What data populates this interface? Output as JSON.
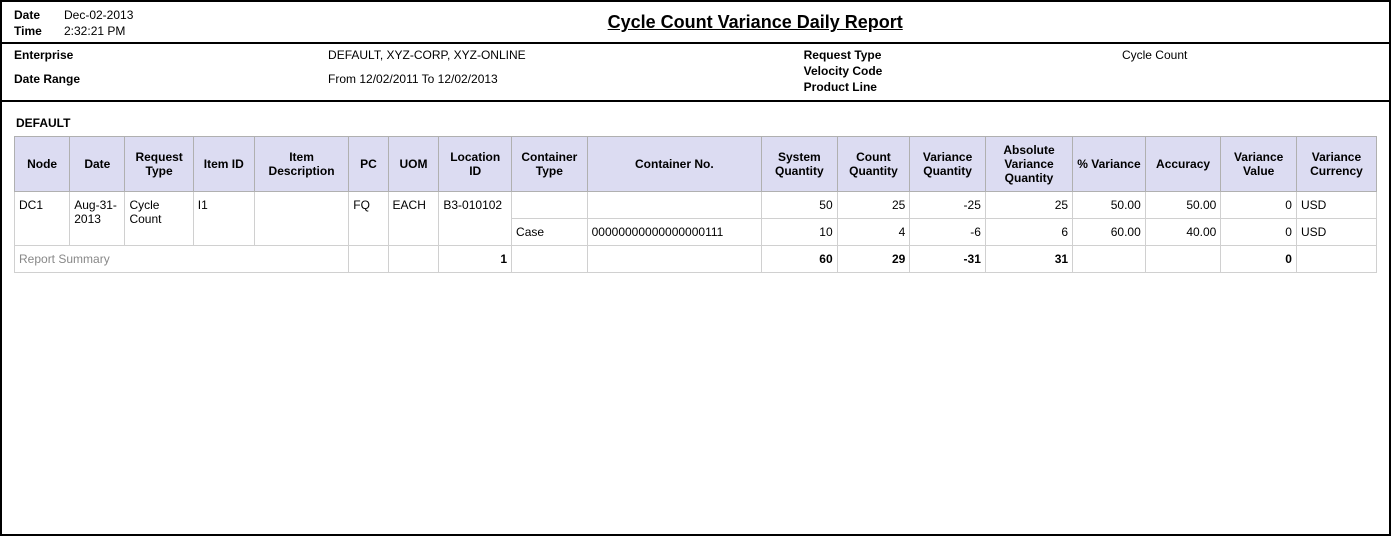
{
  "header": {
    "date_label": "Date",
    "date_value": "Dec-02-2013",
    "time_label": "Time",
    "time_value": "2:32:21 PM",
    "title": "Cycle Count Variance Daily Report"
  },
  "meta": {
    "enterprise_label": "Enterprise",
    "enterprise_value": "DEFAULT, XYZ-CORP, XYZ-ONLINE",
    "date_range_label": "Date Range",
    "date_range_value": "From 12/02/2011 To 12/02/2013",
    "request_type_label": "Request Type",
    "request_type_value": "Cycle Count",
    "velocity_code_label": "Velocity Code",
    "velocity_code_value": "",
    "product_line_label": "Product Line",
    "product_line_value": ""
  },
  "section": {
    "title": "DEFAULT"
  },
  "table": {
    "headers": {
      "node": "Node",
      "date": "Date",
      "request_type": "Request Type",
      "item_id": "Item ID",
      "item_description": "Item Description",
      "pc": "PC",
      "uom": "UOM",
      "location_id": "Location ID",
      "container_type": "Container Type",
      "container_no": "Container No.",
      "system_quantity": "System Quantity",
      "count_quantity": "Count Quantity",
      "variance_quantity": "Variance Quantity",
      "absolute_variance_quantity": "Absolute Variance Quantity",
      "pct_variance": "% Variance",
      "accuracy": "Accuracy",
      "variance_value": "Variance Value",
      "variance_currency": "Variance Currency"
    },
    "group": {
      "node": "DC1",
      "date": "Aug-31-2013",
      "request_type": "Cycle Count",
      "item_id": "I1",
      "item_description": "",
      "pc": "FQ",
      "uom": "EACH",
      "location_id": "B3-010102"
    },
    "rows": [
      {
        "container_type": "",
        "container_no": "",
        "system_quantity": "50",
        "count_quantity": "25",
        "variance_quantity": "-25",
        "absolute_variance_quantity": "25",
        "pct_variance": "50.00",
        "accuracy": "50.00",
        "variance_value": "0",
        "variance_currency": "USD"
      },
      {
        "container_type": "Case",
        "container_no": "00000000000000000111",
        "system_quantity": "10",
        "count_quantity": "4",
        "variance_quantity": "-6",
        "absolute_variance_quantity": "6",
        "pct_variance": "60.00",
        "accuracy": "40.00",
        "variance_value": "0",
        "variance_currency": "USD"
      }
    ],
    "summary": {
      "label": "Report Summary",
      "location_count": "1",
      "system_quantity": "60",
      "count_quantity": "29",
      "variance_quantity": "-31",
      "absolute_variance_quantity": "31",
      "pct_variance": "",
      "accuracy": "",
      "variance_value": "0",
      "variance_currency": ""
    }
  }
}
